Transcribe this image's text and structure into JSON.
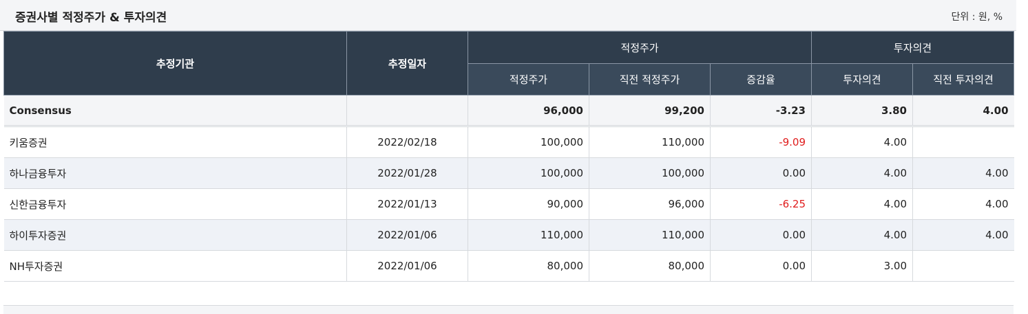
{
  "header": {
    "title": "증권사별 적정주가 & 투자의견",
    "unit": "단위 : 원, %"
  },
  "columns": {
    "agency": "추정기관",
    "date": "추정일자",
    "target_group": "적정주가",
    "opinion_group": "투자의견",
    "target": "적정주가",
    "prev_target": "직전 적정주가",
    "change": "증감율",
    "opinion": "투자의견",
    "prev_opinion": "직전 투자의견"
  },
  "consensus": {
    "name": "Consensus",
    "date": "",
    "target": "96,000",
    "prev_target": "99,200",
    "change": "-3.23",
    "opinion": "3.80",
    "prev_opinion": "4.00"
  },
  "rows": [
    {
      "name": "키움증권",
      "date": "2022/02/18",
      "target": "100,000",
      "prev_target": "110,000",
      "change": "-9.09",
      "opinion": "4.00",
      "prev_opinion": ""
    },
    {
      "name": "하나금융투자",
      "date": "2022/01/28",
      "target": "100,000",
      "prev_target": "100,000",
      "change": "0.00",
      "opinion": "4.00",
      "prev_opinion": "4.00"
    },
    {
      "name": "신한금융투자",
      "date": "2022/01/13",
      "target": "90,000",
      "prev_target": "96,000",
      "change": "-6.25",
      "opinion": "4.00",
      "prev_opinion": "4.00"
    },
    {
      "name": "하이투자증권",
      "date": "2022/01/06",
      "target": "110,000",
      "prev_target": "110,000",
      "change": "0.00",
      "opinion": "4.00",
      "prev_opinion": "4.00"
    },
    {
      "name": "NH투자증권",
      "date": "2022/01/06",
      "target": "80,000",
      "prev_target": "80,000",
      "change": "0.00",
      "opinion": "3.00",
      "prev_opinion": ""
    }
  ],
  "colors": {
    "header_bg": "#2f3d4c",
    "negative": "#e01c1c",
    "alt_row": "#eff2f7"
  }
}
